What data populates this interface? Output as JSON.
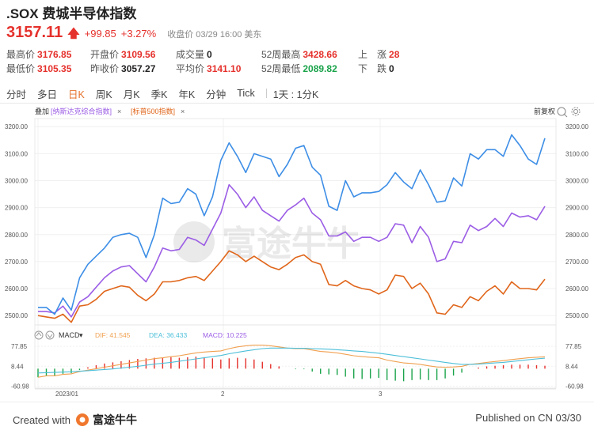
{
  "header": {
    "title": ".SOX 费城半导体指数",
    "price": "3157.11",
    "change": "+99.85",
    "change_pct": "+3.27%",
    "close_info": "收盘价 03/29 16:00 美东"
  },
  "stats": [
    {
      "label": "最高价",
      "value": "3176.85",
      "color": "red"
    },
    {
      "label": "开盘价",
      "value": "3109.56",
      "color": "red"
    },
    {
      "label": "成交量",
      "value": "0",
      "color": "dark"
    },
    {
      "label": "52周最高",
      "value": "3428.66",
      "color": "red"
    },
    {
      "label": "上　涨",
      "value": "28",
      "color": "red"
    },
    {
      "label": "最低价",
      "value": "3105.35",
      "color": "red"
    },
    {
      "label": "昨收价",
      "value": "3057.27",
      "color": "dark"
    },
    {
      "label": "平均价",
      "value": "3141.10",
      "color": "red"
    },
    {
      "label": "52周最低",
      "value": "2089.82",
      "color": "green"
    },
    {
      "label": "下　跌",
      "value": "0",
      "color": "dark"
    }
  ],
  "tabs": [
    "分时",
    "多日",
    "日K",
    "周K",
    "月K",
    "季K",
    "年K",
    "分钟",
    "Tick"
  ],
  "active_tab": "日K",
  "interval": "1天 : 1分K",
  "overlay": {
    "label": "叠加",
    "nasdaq": "[纳斯达克综合指数]",
    "sp500": "[标普500指数]",
    "close_x": "×",
    "adjust": "前复权"
  },
  "macd_legend": {
    "name": "MACD",
    "dif": "DIF: 41.545",
    "dea": "DEA: 36.433",
    "macd": "MACD: 10.225"
  },
  "watermark": "富途牛牛",
  "footer": {
    "created": "Created with",
    "brand": "富途牛牛",
    "published": "Published on CN 03/30"
  },
  "colors": {
    "sox": "#3d8ee6",
    "nasdaq": "#9b5de5",
    "sp500": "#e0661b",
    "up": "#e5312c",
    "down": "#1aa34a",
    "dif": "#f0a050",
    "dea": "#4dbfd9"
  },
  "chart_data": {
    "type": "line",
    "y_ticks": [
      "3200.00",
      "3100.00",
      "3000.00",
      "2900.00",
      "2800.00",
      "2700.00",
      "2600.00",
      "2500.00"
    ],
    "ylim": [
      2480,
      3230
    ],
    "x_labels": [
      "2023/01",
      "2",
      "3"
    ],
    "series": [
      {
        "name": "SOX",
        "values": [
          2530,
          2530,
          2505,
          2565,
          2520,
          2640,
          2690,
          2720,
          2750,
          2790,
          2800,
          2805,
          2790,
          2715,
          2800,
          2935,
          2915,
          2920,
          2970,
          2950,
          2870,
          2940,
          3075,
          3140,
          3090,
          3030,
          3100,
          3090,
          3080,
          3015,
          3060,
          3120,
          3130,
          3050,
          3020,
          2905,
          2890,
          3000,
          2940,
          2955,
          2955,
          2960,
          2985,
          3030,
          2995,
          2970,
          3040,
          2985,
          2920,
          2925,
          3010,
          2980,
          3100,
          3080,
          3115,
          3115,
          3090,
          3170,
          3130,
          3080,
          3060,
          3157
        ]
      },
      {
        "name": "纳斯达克综合指数",
        "values": [
          2515,
          2515,
          2510,
          2535,
          2495,
          2550,
          2570,
          2605,
          2640,
          2665,
          2680,
          2685,
          2655,
          2625,
          2680,
          2750,
          2740,
          2745,
          2790,
          2780,
          2760,
          2820,
          2880,
          2985,
          2950,
          2900,
          2940,
          2890,
          2870,
          2850,
          2890,
          2910,
          2935,
          2880,
          2855,
          2795,
          2795,
          2810,
          2775,
          2790,
          2790,
          2775,
          2790,
          2840,
          2835,
          2770,
          2830,
          2790,
          2700,
          2710,
          2775,
          2770,
          2835,
          2815,
          2830,
          2860,
          2830,
          2880,
          2865,
          2870,
          2855,
          2905
        ]
      },
      {
        "name": "标普500指数",
        "values": [
          2500,
          2495,
          2490,
          2505,
          2475,
          2535,
          2540,
          2560,
          2590,
          2600,
          2610,
          2605,
          2575,
          2555,
          2580,
          2625,
          2625,
          2630,
          2640,
          2645,
          2630,
          2665,
          2700,
          2740,
          2725,
          2700,
          2720,
          2700,
          2680,
          2670,
          2690,
          2715,
          2725,
          2700,
          2690,
          2615,
          2610,
          2630,
          2610,
          2600,
          2595,
          2580,
          2595,
          2650,
          2645,
          2600,
          2620,
          2580,
          2510,
          2505,
          2540,
          2530,
          2570,
          2555,
          2590,
          2610,
          2580,
          2625,
          2600,
          2600,
          2595,
          2635
        ]
      }
    ],
    "macd": {
      "ylim": [
        -68,
        92
      ],
      "y_ticks": [
        "77.85",
        "8.44",
        "-60.98"
      ],
      "dif": [
        -30,
        -25,
        -25,
        -20,
        -18,
        -10,
        -5,
        0,
        5,
        10,
        15,
        20,
        25,
        30,
        35,
        38,
        42,
        45,
        50,
        55,
        58,
        60,
        62,
        70,
        76,
        80,
        82,
        82,
        80,
        76,
        72,
        70,
        70,
        65,
        60,
        58,
        55,
        50,
        45,
        42,
        40,
        38,
        30,
        25,
        20,
        18,
        15,
        10,
        6,
        5,
        6,
        8,
        15,
        18,
        22,
        25,
        28,
        32,
        35,
        38,
        40,
        41.545
      ],
      "dea": [
        -15,
        -14,
        -13,
        -12,
        -11,
        -9,
        -7,
        -5,
        -3,
        -1,
        2,
        5,
        8,
        12,
        16,
        19,
        22,
        26,
        30,
        34,
        38,
        42,
        46,
        52,
        57,
        62,
        66,
        70,
        72,
        72,
        72,
        71,
        71,
        70,
        69,
        68,
        66,
        64,
        62,
        60,
        57,
        54,
        50,
        46,
        42,
        38,
        34,
        30,
        26,
        22,
        18,
        15,
        15,
        16,
        18,
        20,
        22,
        25,
        28,
        31,
        34,
        36.433
      ],
      "hist": [
        -30,
        -24,
        -25,
        -18,
        -16,
        -5,
        5,
        12,
        18,
        22,
        26,
        30,
        34,
        36,
        38,
        38,
        40,
        38,
        40,
        42,
        40,
        36,
        32,
        36,
        38,
        36,
        32,
        24,
        16,
        8,
        0,
        -2,
        -2,
        -10,
        -18,
        -20,
        -22,
        -28,
        -34,
        -36,
        -34,
        -32,
        -40,
        -42,
        -44,
        -40,
        -38,
        -40,
        -40,
        -34,
        -24,
        -14,
        0,
        4,
        8,
        10,
        12,
        14,
        14,
        14,
        12,
        10.225
      ]
    }
  }
}
